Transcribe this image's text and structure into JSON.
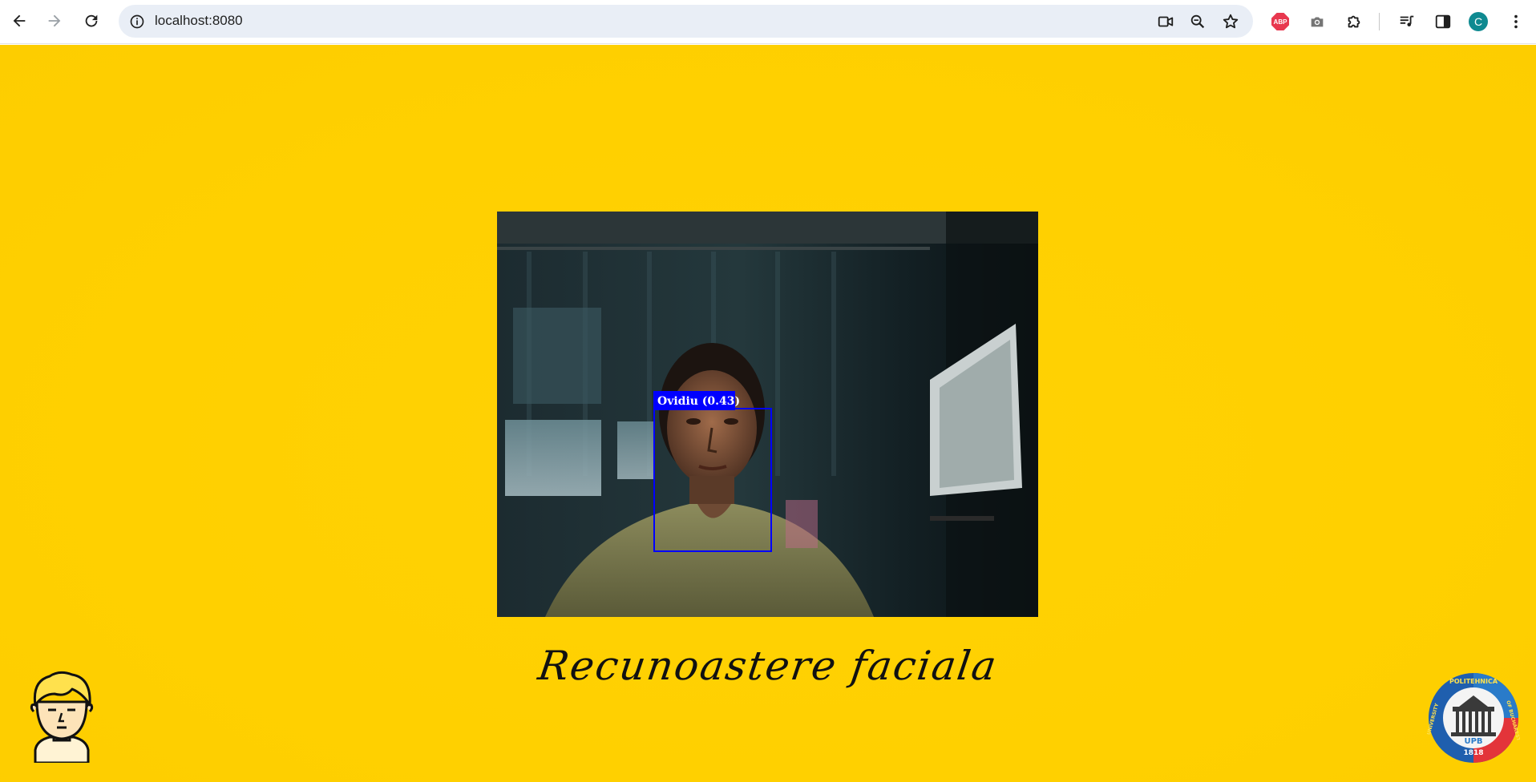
{
  "browser": {
    "url": "localhost:8080",
    "profile_initial": "C",
    "adblock_label": "ABP",
    "icons": {
      "back": "arrow-back-icon",
      "forward": "arrow-forward-icon",
      "reload": "reload-icon",
      "site_info": "info-icon",
      "camera_in_use": "video-camera-icon",
      "zoom": "zoom-icon",
      "bookmark": "star-icon",
      "screenshot": "camera-icon",
      "extensions": "puzzle-icon",
      "media": "media-queue-icon",
      "side_panel": "side-panel-icon",
      "menu": "kebab-menu-icon"
    }
  },
  "page": {
    "background_color": "#ffd000",
    "detection": {
      "label": "Ovidiu (0.43)",
      "box_color": "#0000ff"
    },
    "title": "Recunoastere faciala",
    "logo_right": {
      "top_text": "POLITEHNICA",
      "left_text": "UNIVERSITY",
      "right_text": "OF BUCHAREST",
      "center_text": "UPB",
      "year": "1818"
    }
  }
}
